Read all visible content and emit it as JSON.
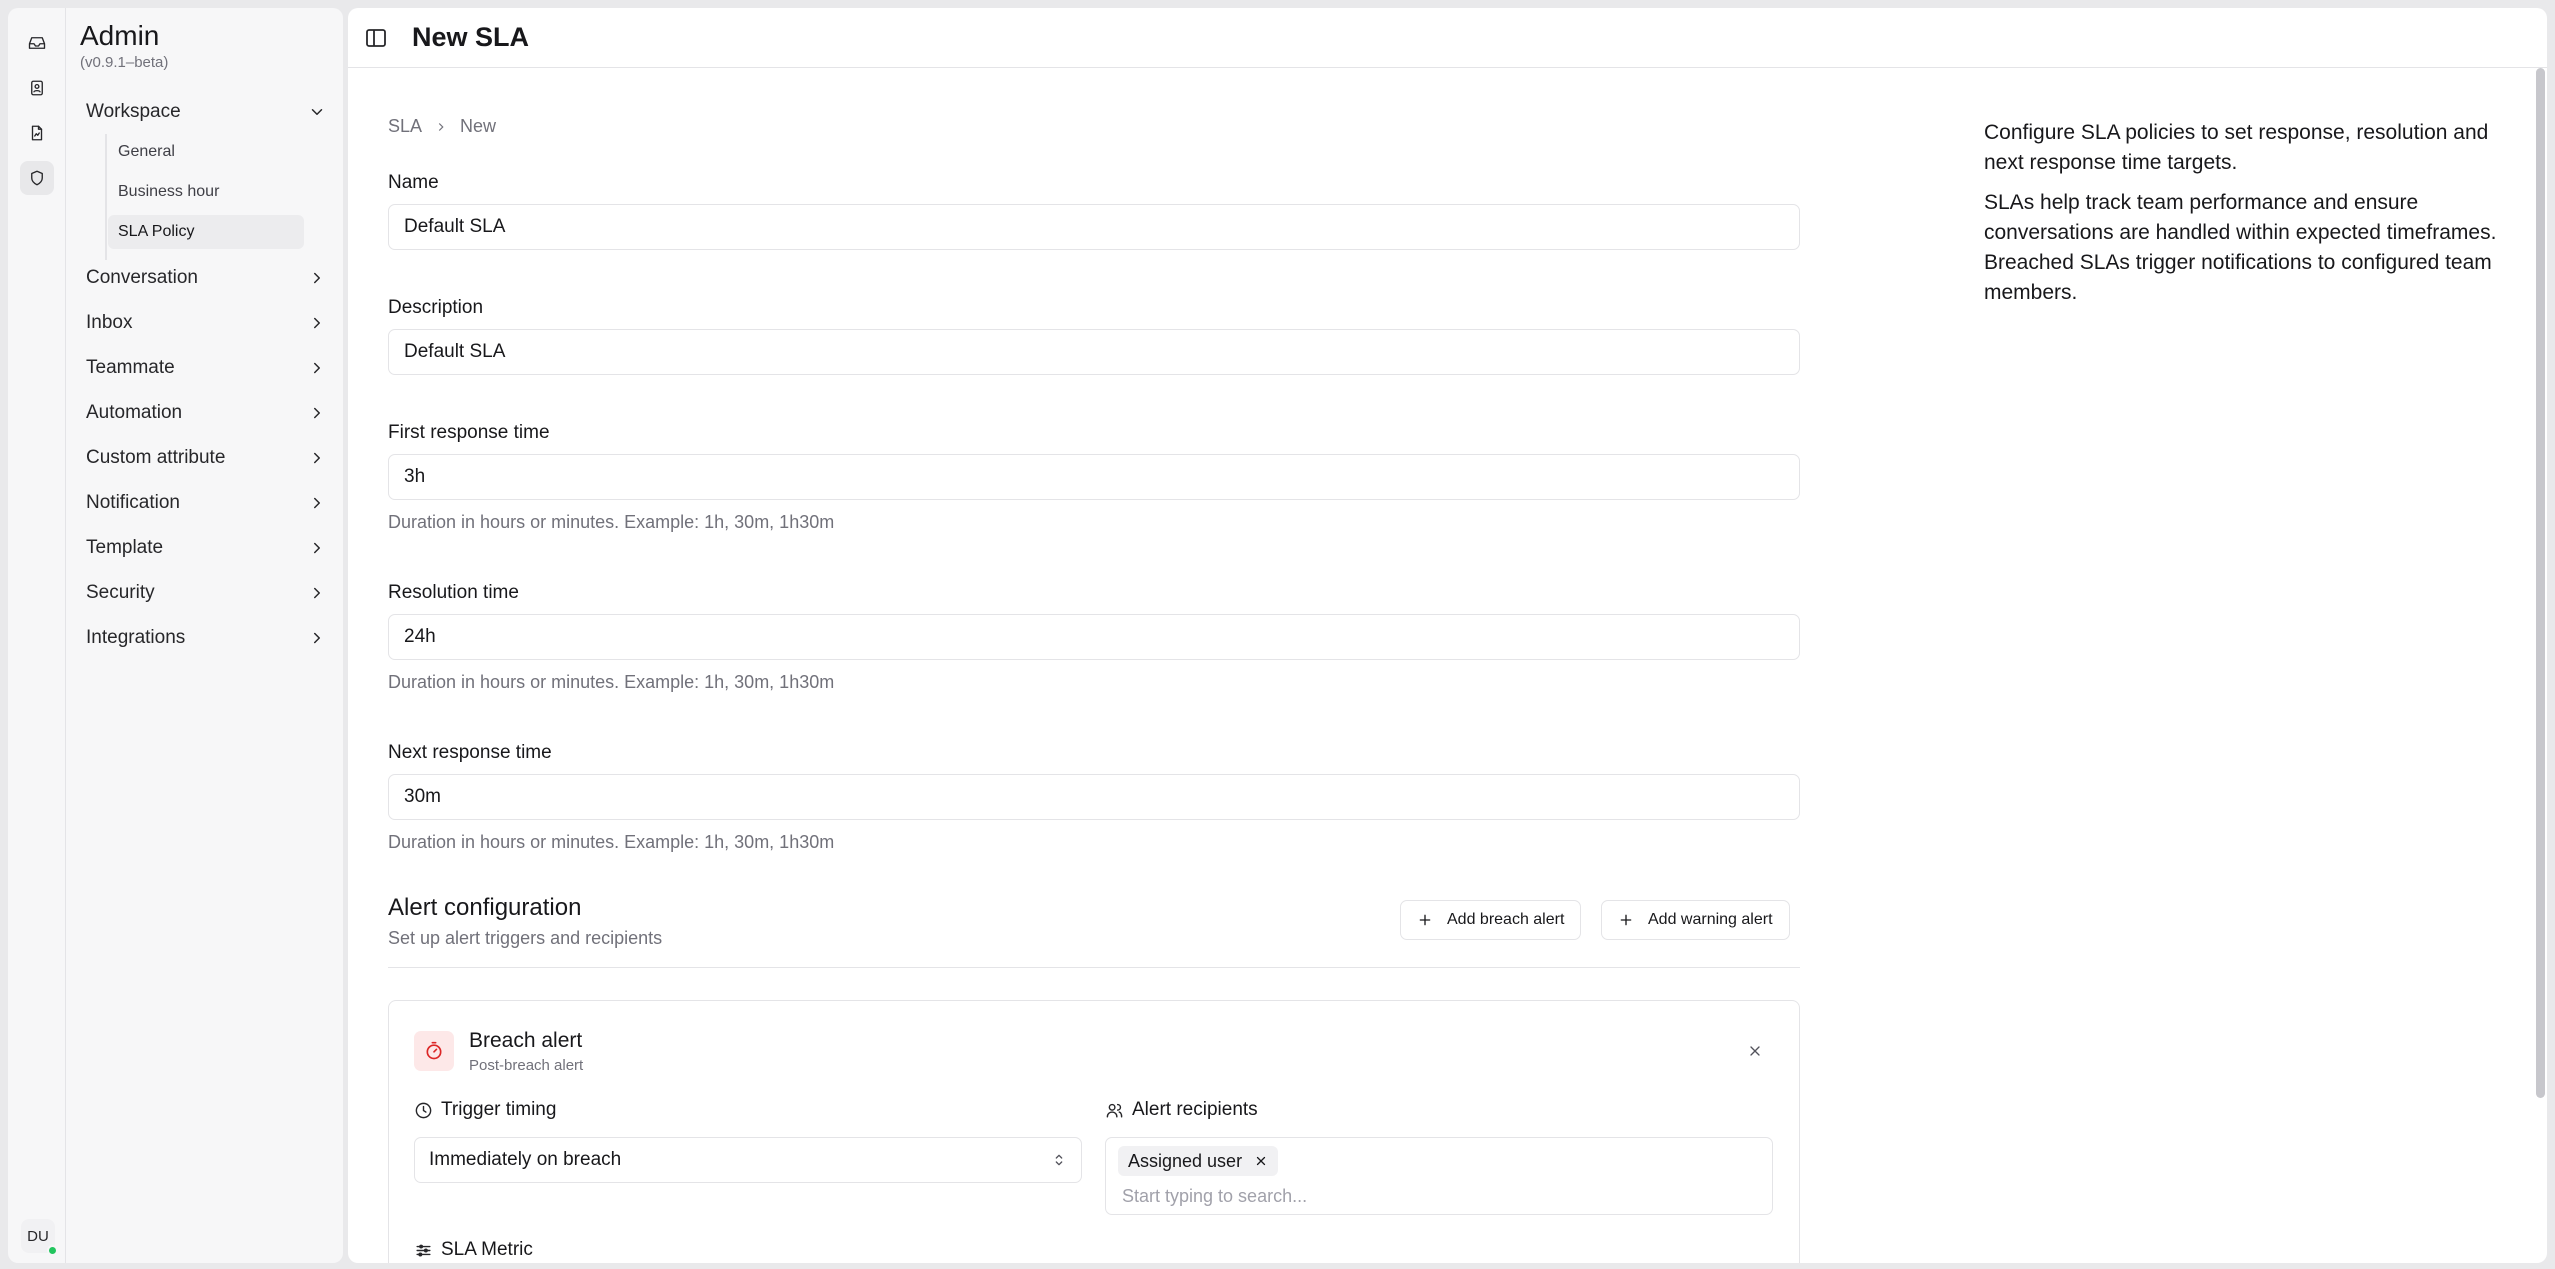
{
  "rail": {
    "icons": [
      "inbox-icon",
      "contacts-icon",
      "reports-icon",
      "admin-shield-icon"
    ],
    "user_initials": "DU",
    "status_color": "#22c55e"
  },
  "sidebar": {
    "title": "Admin",
    "version": "(v0.9.1–beta)",
    "workspace": {
      "label": "Workspace",
      "items": [
        "General",
        "Business hour",
        "SLA Policy"
      ],
      "active": "SLA Policy"
    },
    "groups": [
      "Conversation",
      "Inbox",
      "Teammate",
      "Automation",
      "Custom attribute",
      "Notification",
      "Template",
      "Security",
      "Integrations"
    ]
  },
  "header": {
    "title": "New SLA"
  },
  "breadcrumb": {
    "parent": "SLA",
    "current": "New"
  },
  "form": {
    "name": {
      "label": "Name",
      "value": "Default SLA"
    },
    "description": {
      "label": "Description",
      "value": "Default SLA"
    },
    "first_response": {
      "label": "First response time",
      "value": "3h",
      "hint": "Duration in hours or minutes. Example: 1h, 30m, 1h30m"
    },
    "resolution": {
      "label": "Resolution time",
      "value": "24h",
      "hint": "Duration in hours or minutes. Example: 1h, 30m, 1h30m"
    },
    "next_response": {
      "label": "Next response time",
      "value": "30m",
      "hint": "Duration in hours or minutes. Example: 1h, 30m, 1h30m"
    }
  },
  "alerts": {
    "title": "Alert configuration",
    "subtitle": "Set up alert triggers and recipients",
    "add_breach_label": "Add breach alert",
    "add_warning_label": "Add warning alert",
    "card": {
      "title": "Breach alert",
      "subtitle": "Post-breach alert",
      "accent_color": "#dc2626",
      "trigger_label": "Trigger timing",
      "trigger_value": "Immediately on breach",
      "recipients_label": "Alert recipients",
      "recipient_chip": "Assigned user",
      "recipients_placeholder": "Start typing to search...",
      "metric_label": "SLA Metric"
    }
  },
  "help": {
    "p1": "Configure SLA policies to set response, resolution and next response time targets.",
    "p2": "SLAs help track team performance and ensure conversations are handled within expected timeframes. Breached SLAs trigger notifications to configured team members."
  }
}
